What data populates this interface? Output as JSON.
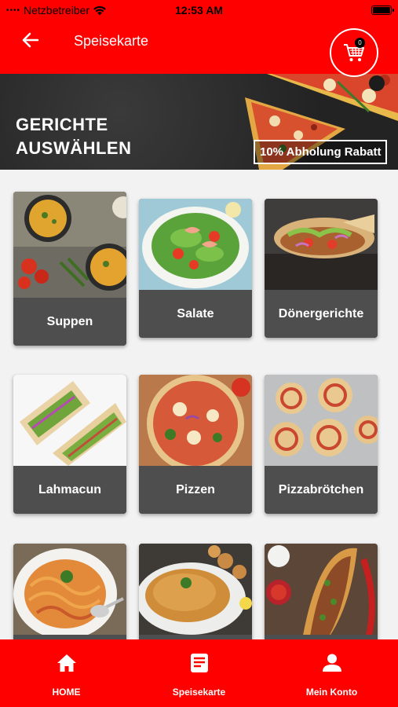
{
  "status_bar": {
    "carrier": "Netzbetreiber",
    "time": "12:53 AM"
  },
  "app_bar": {
    "title": "Speisekarte",
    "back_icon": "arrow-left-icon",
    "cart_icon": "shopping-cart-icon",
    "cart_count": "0"
  },
  "banner": {
    "heading_line1": "GERICHTE",
    "heading_line2": "AUSWÄHLEN",
    "promo": "10% Abholung Rabatt"
  },
  "categories": [
    {
      "label": "Suppen"
    },
    {
      "label": "Salate"
    },
    {
      "label": "Dönergerichte"
    },
    {
      "label": "Lahmacun"
    },
    {
      "label": "Pizzen"
    },
    {
      "label": "Pizzabrötchen"
    },
    {
      "label": ""
    },
    {
      "label": ""
    },
    {
      "label": ""
    }
  ],
  "bottom_nav": [
    {
      "label": "HOME",
      "icon": "home-icon"
    },
    {
      "label": "Speisekarte",
      "icon": "menu-icon"
    },
    {
      "label": "Mein Konto",
      "icon": "user-icon"
    }
  ],
  "colors": {
    "brand_red": "#ff0000",
    "card_label_bg": "#4e4e4e",
    "banner_bg": "#2b2b2b"
  }
}
